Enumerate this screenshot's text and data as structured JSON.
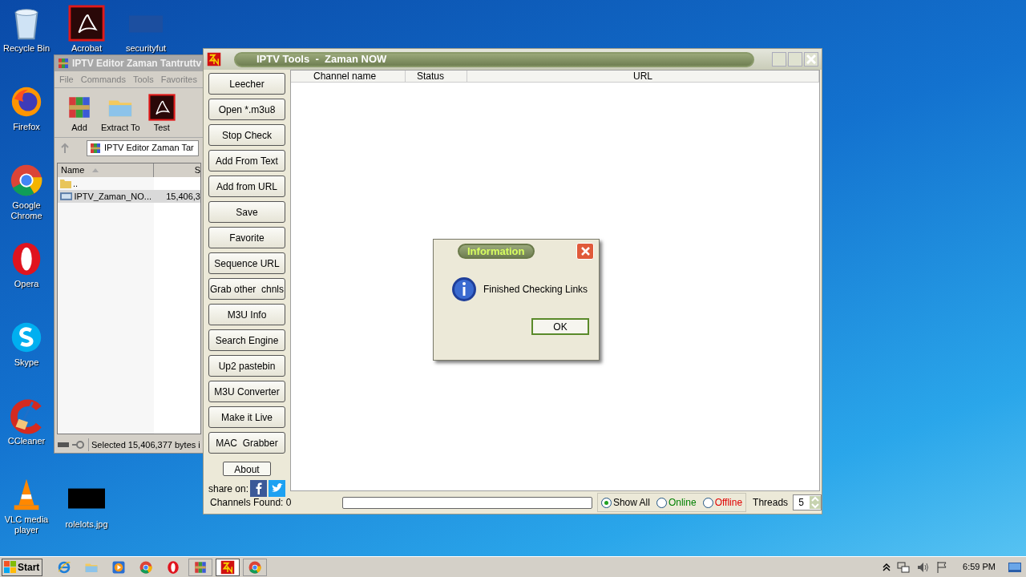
{
  "desktop_icons": [
    {
      "label": "Recycle Bin",
      "kind": "recycle"
    },
    {
      "label": "Firefox",
      "kind": "firefox"
    },
    {
      "label": "Google Chrome",
      "kind": "chrome"
    },
    {
      "label": "Opera",
      "kind": "opera"
    },
    {
      "label": "Skype",
      "kind": "skype"
    },
    {
      "label": "CCleaner",
      "kind": "ccleaner"
    },
    {
      "label": "VLC media player",
      "kind": "vlc"
    },
    {
      "label": "Acrobat",
      "kind": "acrobat"
    },
    {
      "label": "securityfut",
      "kind": "blank"
    },
    {
      "label": "rolelots.jpg",
      "kind": "image"
    }
  ],
  "winrar": {
    "title": "IPTV Editor Zaman Tantruttv",
    "menu": [
      "File",
      "Commands",
      "Tools",
      "Favorites"
    ],
    "toolbar": [
      {
        "label": "Add",
        "kind": "add"
      },
      {
        "label": "Extract To",
        "kind": "extract"
      },
      {
        "label": "Test",
        "kind": "test"
      }
    ],
    "address": "IPTV Editor Zaman Tar",
    "columns": [
      "Name",
      "S"
    ],
    "rows": [
      {
        "name": "..",
        "kind": "folder",
        "selected": false
      },
      {
        "name": "IPTV_Zaman_NO...",
        "size": "15,406,3",
        "kind": "file",
        "selected": true
      }
    ],
    "status": "Selected 15,406,377 bytes i"
  },
  "iptv": {
    "title": "IPTV Tools  -  Zaman NOW",
    "buttons": [
      "Leecher",
      "Open *.m3u8",
      "Stop Check",
      "Add From Text",
      "Add from URL",
      "Save",
      "Favorite",
      "Sequence URL",
      "Grab other  chnls",
      "M3U Info",
      "Search Engine",
      "Up2 pastebin",
      "M3U Converter",
      "Make it Live",
      "MAC  Grabber"
    ],
    "about": "About",
    "share_label": "share on:",
    "columns": [
      "Channel name",
      "Status",
      "URL"
    ],
    "channels_found": "Channels Found: 0",
    "progress": {
      "level": 0
    },
    "filters": [
      {
        "label": "Show All",
        "selected": true,
        "color": "#000000"
      },
      {
        "label": "Online",
        "selected": false,
        "color": "#008000"
      },
      {
        "label": "Offline",
        "selected": false,
        "color": "#e00000"
      }
    ],
    "threads_label": "Threads",
    "threads": "5"
  },
  "dialog": {
    "title": "Information",
    "message": "Finished Checking Links",
    "button": "OK"
  },
  "taskbar": {
    "start": "Start",
    "apps": [
      {
        "kind": "ie",
        "selected": false
      },
      {
        "kind": "explorer",
        "selected": false
      },
      {
        "kind": "media",
        "selected": false
      },
      {
        "kind": "chrome",
        "selected": false
      },
      {
        "kind": "opera",
        "selected": false
      },
      {
        "kind": "winrar",
        "selected": false
      },
      {
        "kind": "iptv",
        "selected": true
      },
      {
        "kind": "chrome",
        "selected": false
      }
    ],
    "clock": "6:59 PM"
  }
}
